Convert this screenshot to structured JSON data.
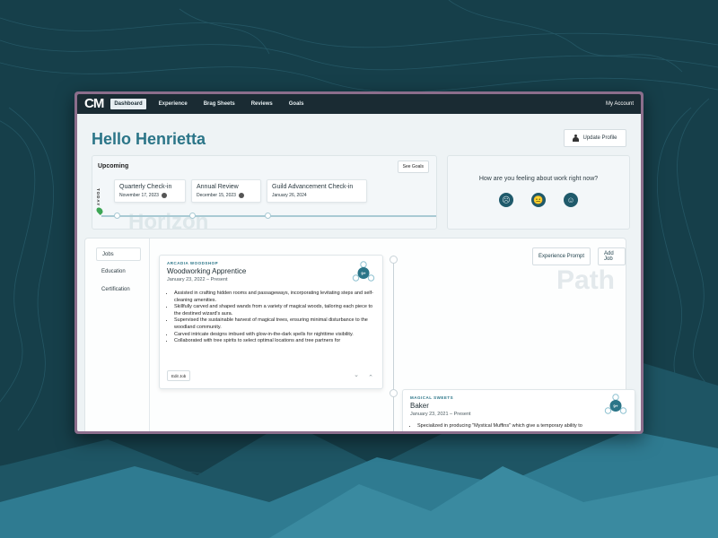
{
  "nav": {
    "logo": "CM",
    "items": [
      {
        "label": "Dashboard",
        "active": true
      },
      {
        "label": "Experience",
        "active": false
      },
      {
        "label": "Brag Sheets",
        "active": false
      },
      {
        "label": "Reviews",
        "active": false
      },
      {
        "label": "Goals",
        "active": false
      }
    ],
    "account": "My Account"
  },
  "header": {
    "greeting": "Hello Henrietta",
    "update_profile": "Update Profile"
  },
  "upcoming": {
    "title": "Upcoming",
    "see_goals": "See Goals",
    "today": "TODAY",
    "watermark": "Horizon",
    "events": [
      {
        "name": "Quarterly Check-in",
        "date": "November 17, 2023"
      },
      {
        "name": "Annual Review",
        "date": "December 15, 2023"
      },
      {
        "name": "Guild Advancement Check-in",
        "date": "January 26, 2024"
      }
    ]
  },
  "mood": {
    "question": "How are you feeling about work right now?",
    "faces": [
      "☹",
      "😐",
      "☺"
    ]
  },
  "experience": {
    "sidebar": [
      {
        "label": "Jobs",
        "active": true
      },
      {
        "label": "Education",
        "active": false
      },
      {
        "label": "Certification",
        "active": false
      }
    ],
    "watermark": "Path",
    "experience_prompt": "Experience Prompt",
    "add_job": "Add Job",
    "jobs": [
      {
        "company": "ARCADIA WOODSHOP",
        "title": "Woodworking Apprentice",
        "dates": "January 23, 2022 – Present",
        "badge": "9+",
        "bullets": [
          "Assisted in crafting hidden rooms and passageways, incorporating levitating steps and self-cleaning amenities.",
          "Skillfully carved and shaped wands from a variety of magical woods, tailoring each piece to the destined wizard's aura.",
          "Supervised the sustainable harvest of magical trees, ensuring minimal disturbance to the woodland community.",
          "Carved intricate designs imbued with glow-in-the-dark spells for nighttime visibility.",
          "Collaborated with tree spirits to select optimal locations and tree partners for"
        ],
        "edit": "Edit Job"
      },
      {
        "company": "MAGICAL SWEETS",
        "title": "Baker",
        "dates": "January 23, 2021 – Present",
        "badge": "9+",
        "bullets": [
          "Specialized in producing \"Mystical Muffins\" which give a temporary ability to"
        ]
      }
    ]
  },
  "colors": {
    "accent": "#2b7588",
    "navbar": "#1a2b33",
    "frame": "#8c6e8c",
    "background": "#163f4a"
  }
}
